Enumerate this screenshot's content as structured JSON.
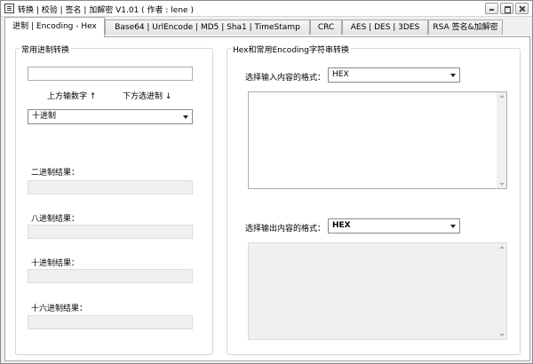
{
  "window": {
    "title": "转换 | 校验 | 签名 | 加解密 V1.01  ( 作者 : lene )"
  },
  "tabs": [
    {
      "label": "进制 | Encoding - Hex",
      "active": true
    },
    {
      "label": "Base64 | UrlEncode | MD5 | Sha1 | TimeStamp",
      "active": false
    },
    {
      "label": "CRC",
      "active": false
    },
    {
      "label": "AES | DES | 3DES",
      "active": false
    },
    {
      "label": "RSA 签名&加解密",
      "active": false
    }
  ],
  "left_group": {
    "title": "常用进制转换",
    "number_input": {
      "value": ""
    },
    "hint_input": "上方输数字 ↑",
    "hint_select": "下方选进制 ↓",
    "base_select": {
      "value": "十进制"
    },
    "results": [
      {
        "label": "二进制结果：",
        "value": ""
      },
      {
        "label": "八进制结果：",
        "value": ""
      },
      {
        "label": "十进制结果：",
        "value": ""
      },
      {
        "label": "十六进制结果：",
        "value": ""
      }
    ]
  },
  "right_group": {
    "title": "Hex和常用Encoding字符串转换",
    "input_format_label": "选择输入内容的格式：",
    "input_format_select": {
      "value": "HEX"
    },
    "input_text": {
      "value": ""
    },
    "output_format_label": "选择输出内容的格式：",
    "output_format_select": {
      "value": "HEX"
    },
    "output_text": {
      "value": ""
    }
  }
}
